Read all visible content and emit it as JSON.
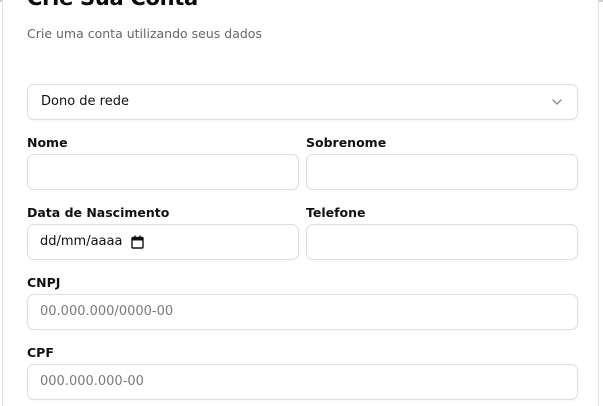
{
  "header": {
    "title": "Crie Sua Conta",
    "subtitle": "Crie uma conta utilizando seus dados"
  },
  "account_type": {
    "selected": "Dono de rede",
    "icon": "chevron-down-icon"
  },
  "fields": {
    "nome": {
      "label": "Nome",
      "value": ""
    },
    "sobrenome": {
      "label": "Sobrenome",
      "value": ""
    },
    "data_nascimento": {
      "label": "Data de Nascimento",
      "value": "dd/mm/aaaa",
      "icon": "calendar-icon"
    },
    "telefone": {
      "label": "Telefone",
      "value": ""
    },
    "cnpj": {
      "label": "CNPJ",
      "placeholder": "00.000.000/0000-00"
    },
    "cpf": {
      "label": "CPF",
      "placeholder": "000.000.000-00"
    }
  }
}
